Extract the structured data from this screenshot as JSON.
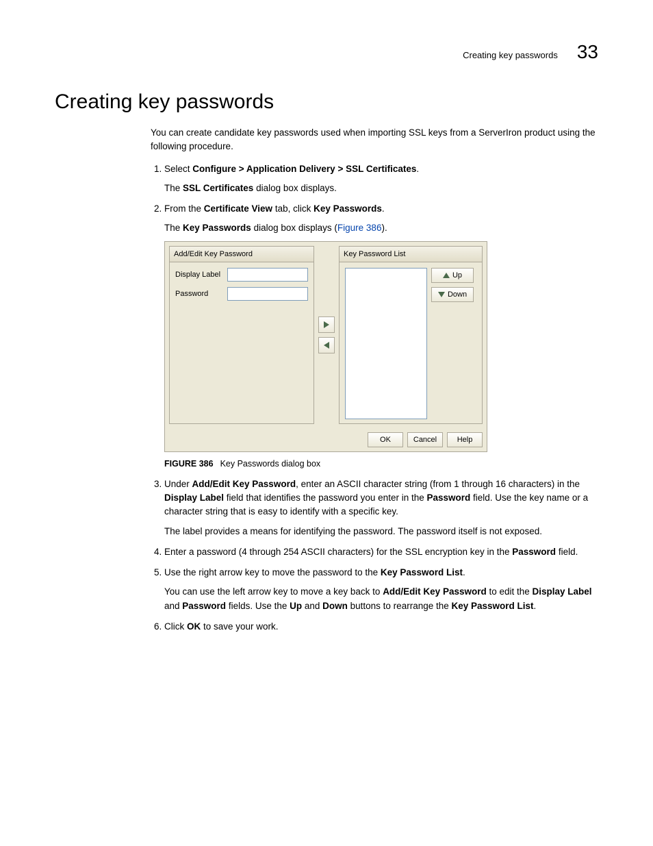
{
  "header": {
    "title": "Creating key passwords",
    "chapter_number": "33"
  },
  "h1": "Creating key passwords",
  "intro": "You can create candidate key passwords used when importing SSL keys from a ServerIron product using the following procedure.",
  "steps": {
    "s1": {
      "lead": "Select ",
      "bold": "Configure > Application Delivery > SSL Certificates",
      "tail": ".",
      "p2a": "The ",
      "p2b": "SSL Certificates",
      "p2c": " dialog box displays."
    },
    "s2": {
      "lead": "From the ",
      "bold1": "Certificate View",
      "mid": " tab, click ",
      "bold2": "Key Passwords",
      "tail": ".",
      "p2a": "The ",
      "p2b": "Key Passwords",
      "p2c": " dialog box displays (",
      "link": "Figure 386",
      "p2e": ")."
    },
    "s3": {
      "t1": "Under ",
      "b1": "Add/Edit Key Password",
      "t2": ", enter an ASCII character string (from 1 through 16 characters) in the ",
      "b2": "Display Label",
      "t3": " field that identifies the password you enter in the ",
      "b3": "Password",
      "t4": " field. Use the key name or a character string that is easy to identify with a specific key.",
      "p2": "The label provides a means for identifying the password. The password itself is not exposed."
    },
    "s4": {
      "t1": "Enter a password (4 through 254 ASCII characters) for the SSL encryption key in the ",
      "b1": "Password",
      "t2": " field."
    },
    "s5": {
      "t1": "Use the right arrow key to move the password to the ",
      "b1": "Key Password List",
      "t2": ".",
      "p2a": "You can use the left arrow key to move a key back to ",
      "p2b": "Add/Edit Key Password",
      "p2c": " to edit the ",
      "p2d": "Display Label",
      "p2e": " and ",
      "p2f": "Password",
      "p2g": " fields. Use the ",
      "p2h": "Up",
      "p2i": " and ",
      "p2j": "Down",
      "p2k": " buttons to rearrange the ",
      "p2l": "Key Password List",
      "p2m": "."
    },
    "s6": {
      "t1": "Click ",
      "b1": "OK",
      "t2": " to save your work."
    }
  },
  "figure": {
    "left_panel_title": "Add/Edit Key Password",
    "label_display": "Display Label",
    "label_password": "Password",
    "right_panel_title": "Key Password List",
    "btn_up": "Up",
    "btn_down": "Down",
    "btn_ok": "OK",
    "btn_cancel": "Cancel",
    "btn_help": "Help",
    "caption_no": "FIGURE 386",
    "caption_text": "Key Passwords dialog box"
  }
}
